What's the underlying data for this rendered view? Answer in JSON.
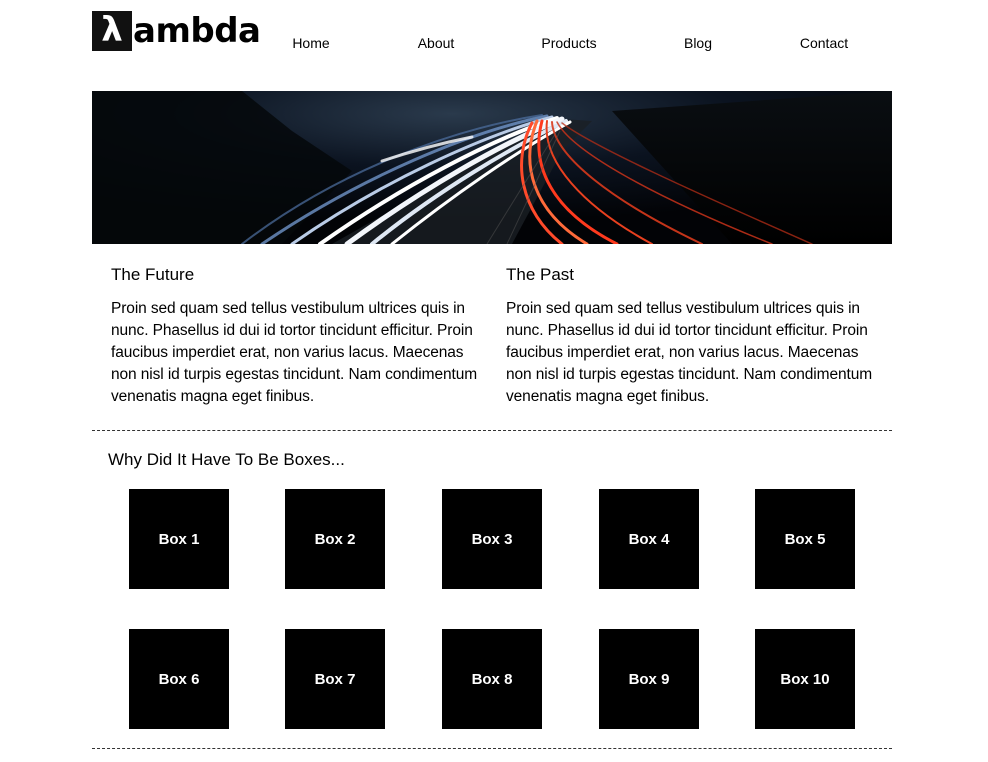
{
  "brand": {
    "mark": "λ",
    "name": "ambda"
  },
  "nav": {
    "items": [
      {
        "label": "Home"
      },
      {
        "label": "About"
      },
      {
        "label": "Products"
      },
      {
        "label": "Blog"
      },
      {
        "label": "Contact"
      }
    ]
  },
  "hero": {
    "image": "night-highway-light-trails"
  },
  "articles": [
    {
      "title": "The Future",
      "body": "Proin sed quam sed tellus vestibulum ultrices quis in nunc. Phasellus id dui id tortor tincidunt efficitur. Proin faucibus imperdiet erat, non varius lacus. Maecenas non nisl id turpis egestas tincidunt. Nam condimentum venenatis magna eget finibus."
    },
    {
      "title": "The Past",
      "body": "Proin sed quam sed tellus vestibulum ultrices quis in nunc. Phasellus id dui id tortor tincidunt efficitur. Proin faucibus imperdiet erat, non varius lacus. Maecenas non nisl id turpis egestas tincidunt. Nam condimentum venenatis magna eget finibus."
    }
  ],
  "boxes_section": {
    "title": "Why Did It Have To Be Boxes...",
    "boxes": [
      "Box 1",
      "Box 2",
      "Box 3",
      "Box 4",
      "Box 5",
      "Box 6",
      "Box 7",
      "Box 8",
      "Box 9",
      "Box 10"
    ]
  }
}
